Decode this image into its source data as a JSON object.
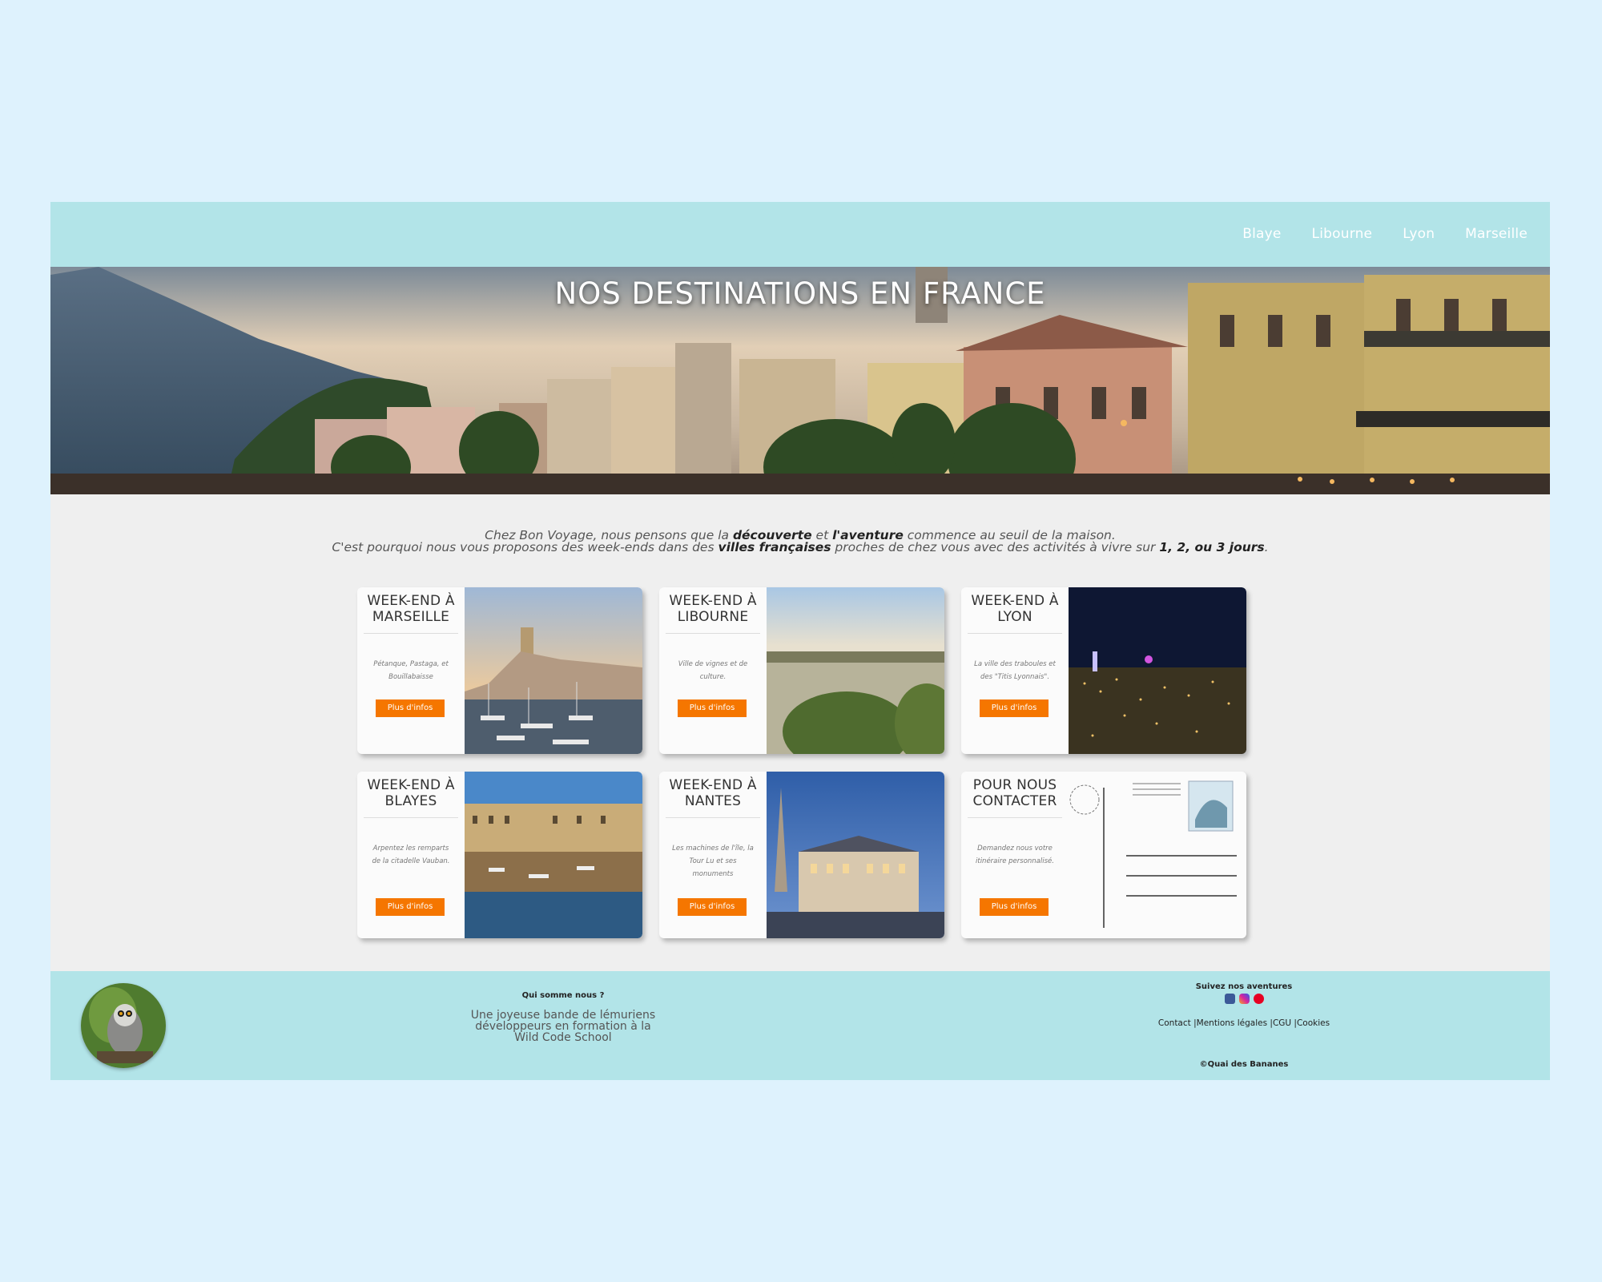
{
  "nav": {
    "links": [
      "Blaye",
      "Libourne",
      "Lyon",
      "Marseille"
    ]
  },
  "hero": {
    "title": "NOS DESTINATIONS EN FRANCE"
  },
  "intro": {
    "line1_a": "Chez Bon Voyage, nous pensons que la ",
    "line1_b": "découverte",
    "line1_c": " et ",
    "line1_d": "l'aventure",
    "line1_e": " commence au seuil de la maison.",
    "line2_a": "C'est pourquoi nous vous proposons des week-ends dans des ",
    "line2_b": "villes françaises",
    "line2_c": " proches de chez vous avec des activités à vivre sur ",
    "line2_d": "1, 2, ou 3 jours",
    "line2_e": "."
  },
  "cards": [
    {
      "title": "WEEK-END À MARSEILLE",
      "desc": "Pétanque, Pastaga, et Bouillabaisse",
      "button": "Plus d'infos"
    },
    {
      "title": "WEEK-END À LIBOURNE",
      "desc": "Ville de vignes et de culture.",
      "button": "Plus d'infos"
    },
    {
      "title": "WEEK-END À LYON",
      "desc": "La ville des traboules et des \"Titis Lyonnais\".",
      "button": "Plus d'infos"
    },
    {
      "title": "WEEK-END À BLAYES",
      "desc": "Arpentez les remparts de la citadelle Vauban.",
      "button": "Plus d'infos"
    },
    {
      "title": "WEEK-END À NANTES",
      "desc": "Les machines de l'île, la Tour Lu et ses monuments",
      "button": "Plus d'infos"
    },
    {
      "title": "POUR NOUS CONTACTER",
      "desc": "Demandez nous votre itinéraire personnalisé.",
      "button": "Plus d'infos"
    }
  ],
  "footer": {
    "who_title": "Qui somme nous ?",
    "who_text": "Une joyeuse bande de lémuriens développeurs en formation à la Wild Code School",
    "follow": "Suivez nos aventures",
    "social_icons": [
      "facebook-icon",
      "instagram-icon",
      "pinterest-icon"
    ],
    "link_contact": "Contact |",
    "link_mentions": "Mentions légales |",
    "link_cgu": "CGU |",
    "link_cookies": "Cookies",
    "copyright": "©Quai des Bananes"
  },
  "colors": {
    "page_bg": "#def2fd",
    "nav_bg": "#b2e4e8",
    "button": "#f57600"
  }
}
